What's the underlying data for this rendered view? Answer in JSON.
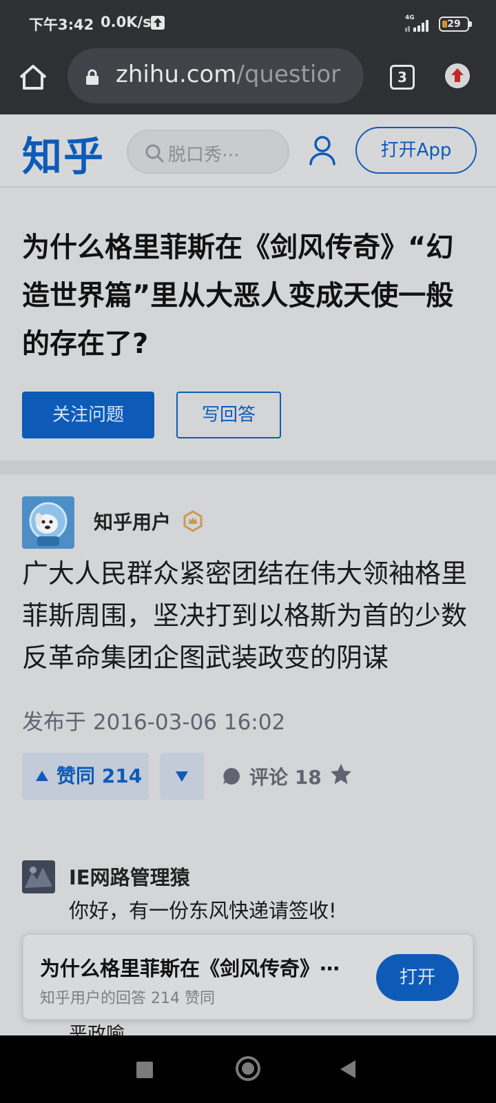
{
  "status_bar": {
    "time": "下午3:42",
    "net_speed": "0.0K/s",
    "signal_label": "4G",
    "battery": "29"
  },
  "browser": {
    "url_host": "zhihu.com",
    "url_path": "/questior",
    "tab_count": "3"
  },
  "header": {
    "logo": "知乎",
    "search_placeholder": "脱口秀⋯",
    "open_app_label": "打开App"
  },
  "question": {
    "title": "为什么格里菲斯在《剑风传奇》“幻造世界篇”里从大恶人变成天使一般的存在了?",
    "follow_label": "关注问题",
    "write_answer_label": "写回答"
  },
  "answer": {
    "author": "知乎用户",
    "content": "广大人民群众紧密团结在伟大领袖格里菲斯周围，坚决打到以格斯为首的少数反革命集团企图武装政变的阴谋",
    "publish_time": "发布于 2016-03-06 16:02",
    "vote_label": "赞同 214",
    "comment_label": "评论 18"
  },
  "comment_preview": {
    "author": "IE网路管理猿",
    "text": "你好，有一份东风快递请签收!",
    "text2": "恶政喻"
  },
  "banner": {
    "title": "为什么格里菲斯在《剑风传奇》⋯",
    "subtitle": "知乎用户的回答 214 赞同",
    "open_label": "打开"
  },
  "colors": {
    "brand_blue": "#0d5bb7",
    "status_bar_bg": "#2e3033",
    "badge_gold": "#c99a4e"
  },
  "icons": [
    "home-icon",
    "lock-icon",
    "tabs-icon",
    "update-icon",
    "search-icon",
    "user-icon",
    "badge-icon",
    "comment-icon",
    "star-icon",
    "upload-icon",
    "signal-icon"
  ]
}
